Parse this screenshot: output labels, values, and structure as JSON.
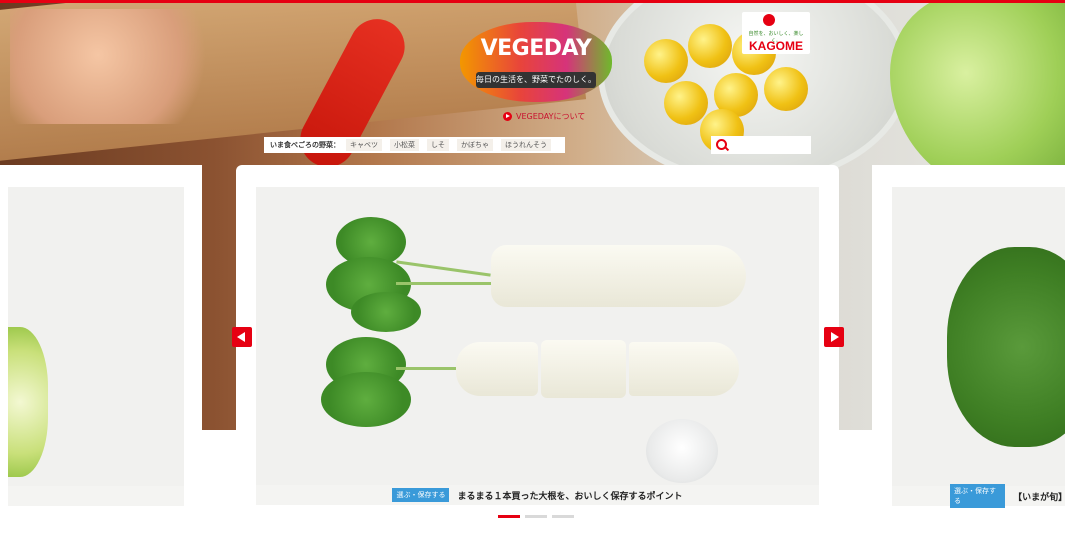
{
  "brand": {
    "logo_title": "VEGEDAY",
    "logo_tagline": "毎日の生活を、野菜でたのしく。",
    "about_link": "VEGEDAYについて",
    "partner_tagline": "自然を、おいしく、楽しく。",
    "partner_name": "KAGOME"
  },
  "seasonal": {
    "label": "いま食べごろの野菜：",
    "items": [
      "キャベツ",
      "小松菜",
      "しそ",
      "かぼちゃ",
      "ほうれんそう"
    ]
  },
  "search": {
    "placeholder": ""
  },
  "carousel": {
    "center_card": {
      "badge": "選ぶ・保存する",
      "title": "まるまる１本買った大根を、おいしく保存するポイント"
    },
    "right_card": {
      "badge": "選ぶ・保存する",
      "title": "【いまが旬】"
    },
    "pager": {
      "total": 3,
      "active": 1
    }
  },
  "colors": {
    "accent": "#e60012",
    "badge": "#3a9ad9"
  }
}
